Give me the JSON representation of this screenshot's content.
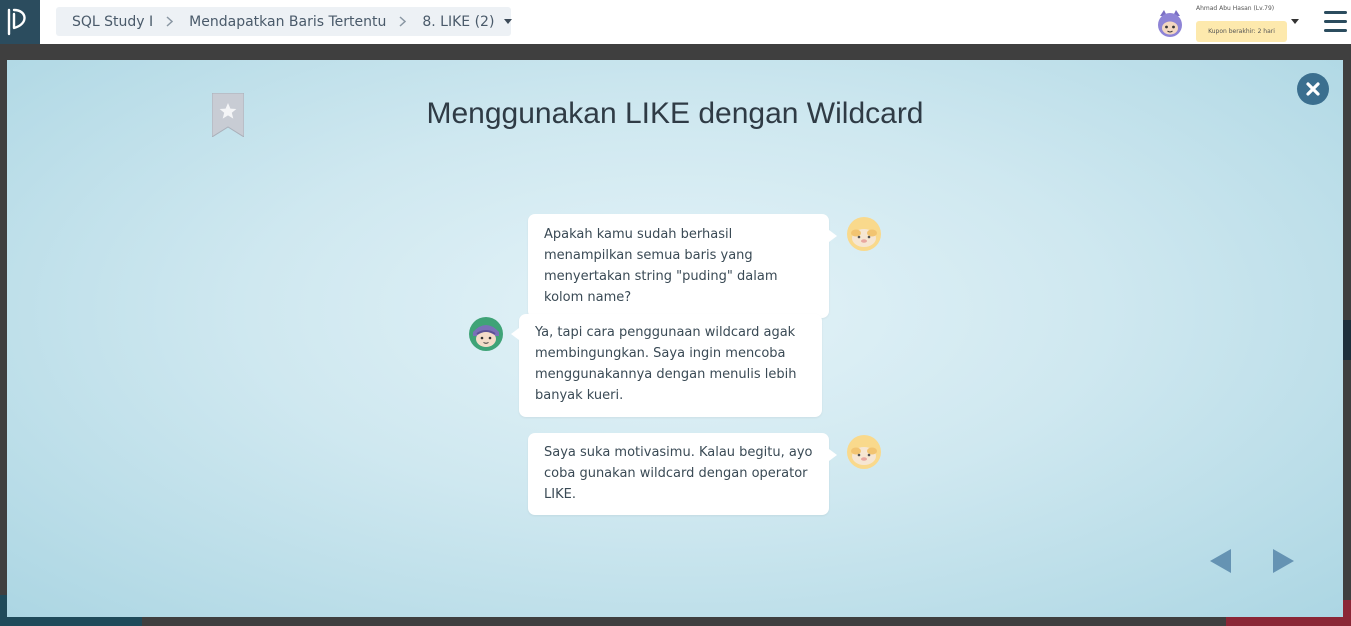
{
  "topbar": {
    "breadcrumb": {
      "course": "SQL Study I",
      "chapter": "Mendapatkan Baris Tertentu",
      "lesson": "8. LIKE (2)"
    },
    "user": {
      "name": "Ahmad Abu Hasan (Lv.79)",
      "coupon": "Kupon berakhir: 2 hari"
    }
  },
  "modal": {
    "title": "Menggunakan LIKE dengan Wildcard",
    "messages": [
      {
        "side": "right",
        "speaker": "teacher",
        "text": "Apakah kamu sudah berhasil menampilkan semua baris yang menyertakan string \"puding\" dalam kolom name?"
      },
      {
        "side": "left",
        "speaker": "student",
        "text": "Ya, tapi cara penggunaan wildcard agak membingungkan. Saya ingin mencoba menggunakannya dengan menulis lebih banyak kueri."
      },
      {
        "side": "right",
        "speaker": "teacher",
        "text": "Saya suka motivasimu. Kalau begitu, ayo coba gunakan wildcard dengan operator LIKE."
      }
    ]
  },
  "colors": {
    "brand_dark": "#2b4c5e",
    "close_button": "#3b6f8f",
    "nav_arrow": "#6593b3",
    "coupon_bg": "#fde9ad"
  },
  "icons": {
    "logo": "progate-logo-icon",
    "close": "close-x-icon",
    "bookmark": "bookmark-star-icon",
    "prev": "triangle-left-icon",
    "next": "triangle-right-icon",
    "menu": "hamburger-menu-icon"
  }
}
